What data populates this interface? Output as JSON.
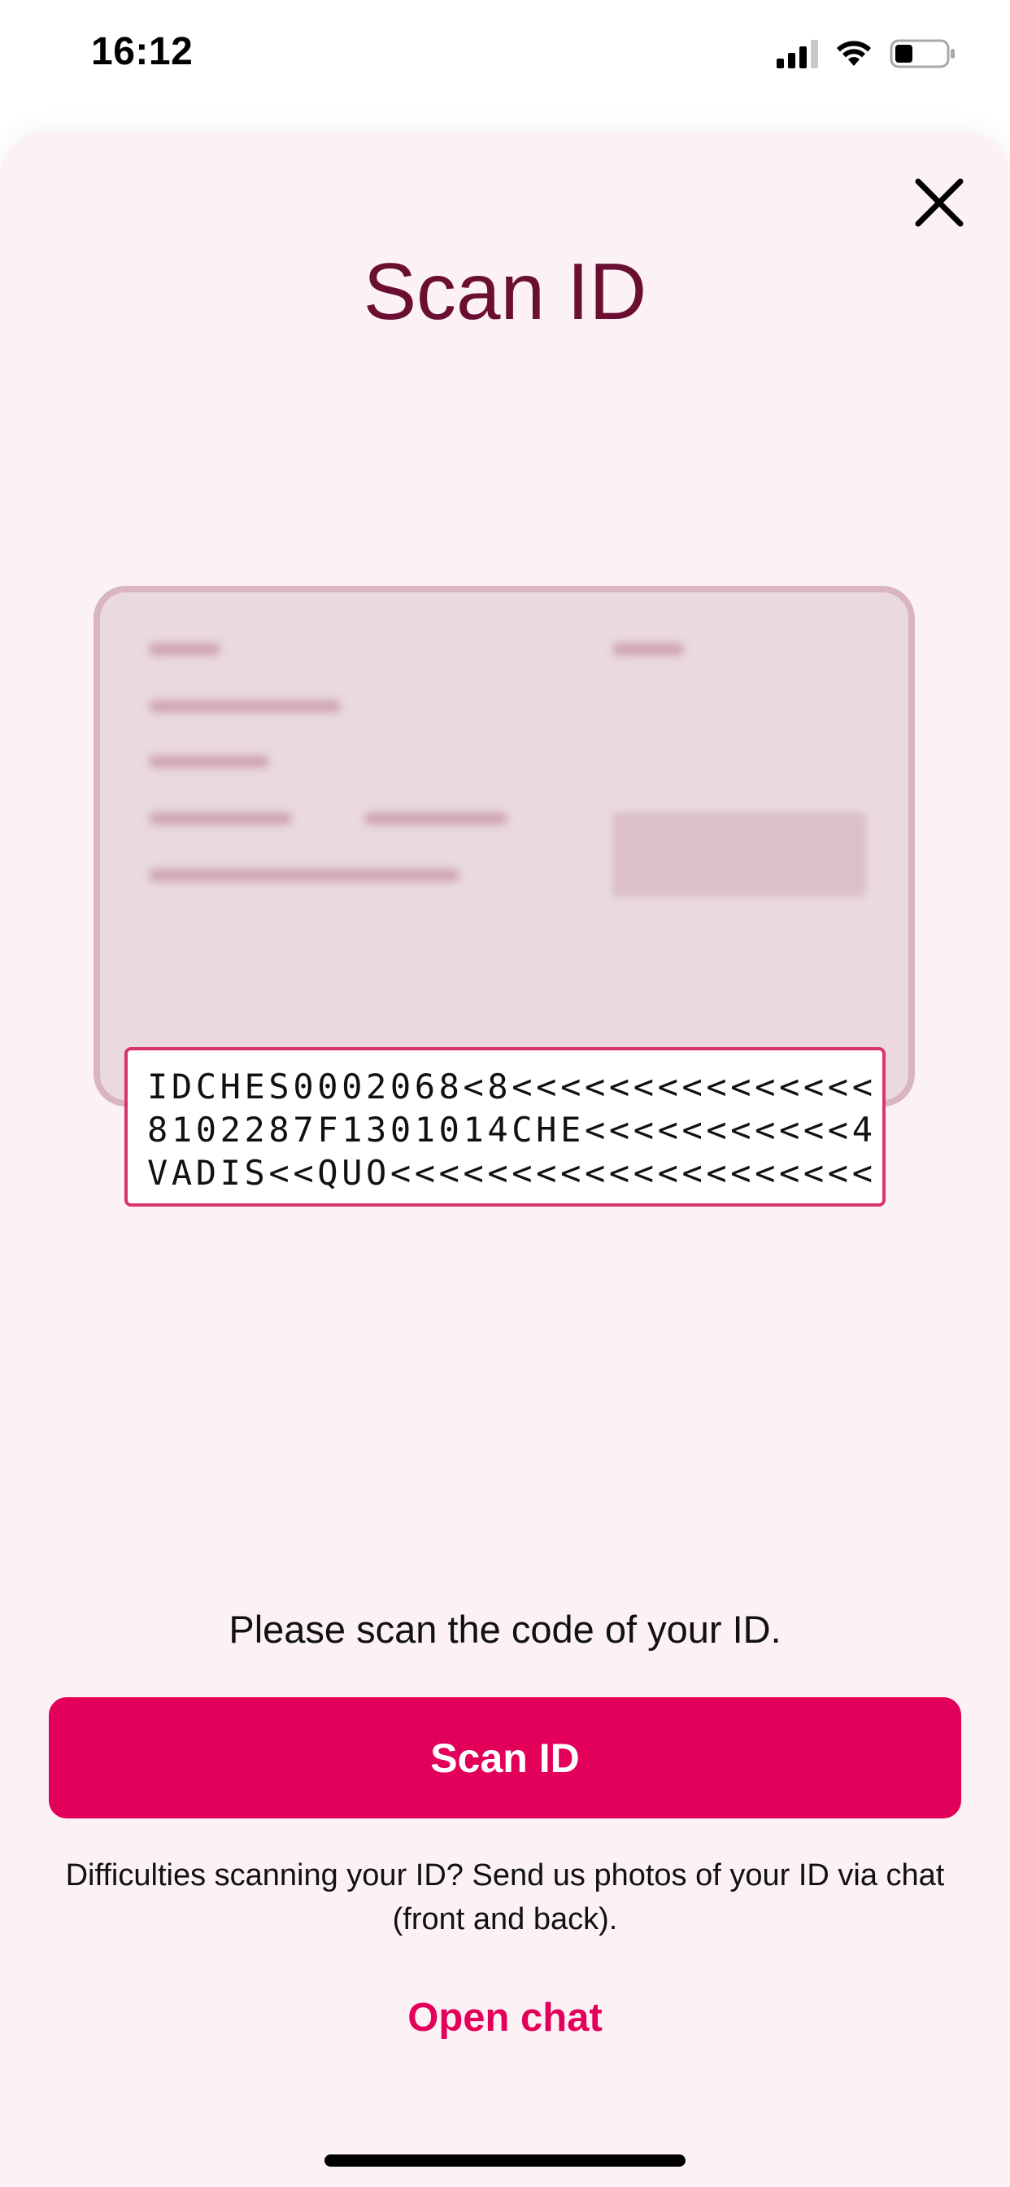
{
  "status_bar": {
    "time": "16:12",
    "icons": [
      "cellular-signal-icon",
      "wifi-icon",
      "battery-icon"
    ],
    "battery_level": 0.35
  },
  "sheet": {
    "title": "Scan ID",
    "close_icon": "close-icon"
  },
  "id_card": {
    "mrz_lines": [
      "IDCHES0002068<8<<<<<<<<<<<<<<<",
      "8102287F1301014CHE<<<<<<<<<<<4",
      "VADIS<<QUO<<<<<<<<<<<<<<<<<<<<"
    ]
  },
  "instruction": "Please scan the code of your ID.",
  "scan_button_label": "Scan ID",
  "help_text": "Difficulties scanning your ID? Send us photos of your ID via chat (front and back).",
  "open_chat_label": "Open chat",
  "colors": {
    "accent": "#e2005a",
    "title": "#6b0f32",
    "sheet_background": "#fcf2f5",
    "mrz_border": "#d9346f"
  }
}
